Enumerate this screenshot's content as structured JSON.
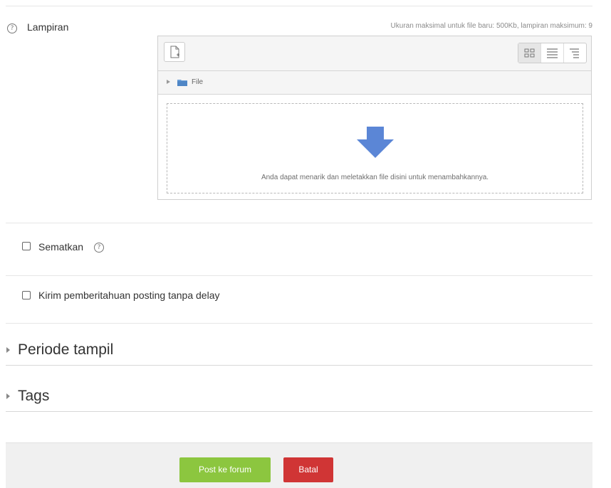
{
  "attachments": {
    "label": "Lampiran",
    "limit_text": "Ukuran maksimal untuk file baru: 500Kb, lampiran maksimum: 9",
    "path_label": "File",
    "drop_text": "Anda dapat menarik dan meletakkan file disini untuk menambahkannya."
  },
  "options": {
    "pin_label": "Sematkan",
    "notify_label": "Kirim pemberitahuan posting tanpa delay"
  },
  "sections": {
    "display_period": "Periode tampil",
    "tags": "Tags"
  },
  "buttons": {
    "post": "Post ke forum",
    "cancel": "Batal"
  },
  "colors": {
    "post_button": "#8cc63f",
    "cancel_button": "#d03535",
    "arrow": "#5b86d6"
  },
  "icons": {
    "help": "question-circle-icon",
    "add_file": "file-add-icon",
    "grid": "grid-view-icon",
    "list": "list-view-icon",
    "tree": "tree-view-icon",
    "folder": "folder-icon",
    "drop": "down-arrow-icon"
  }
}
